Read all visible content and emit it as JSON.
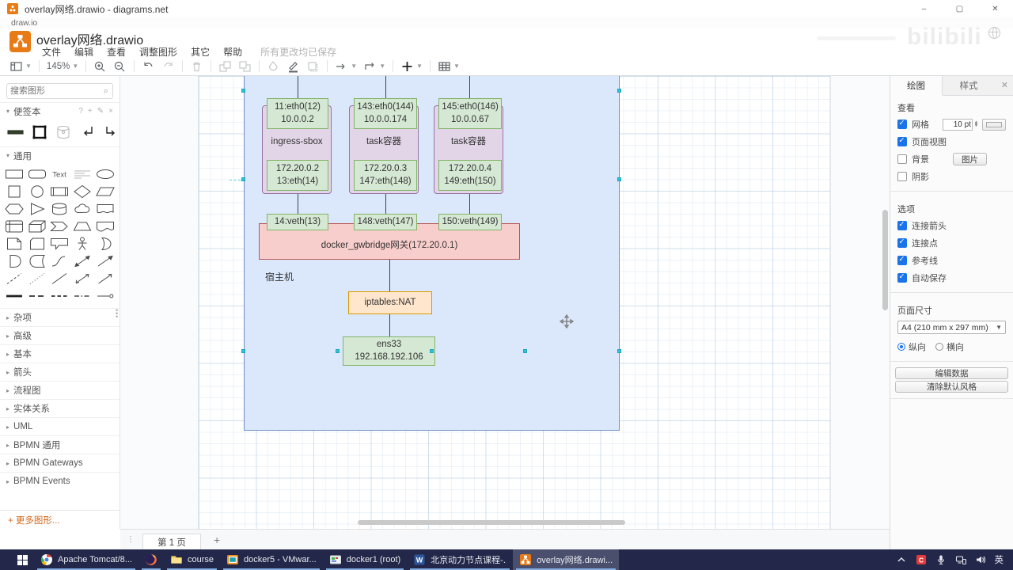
{
  "window": {
    "title": "overlay网络.drawio - diagrams.net",
    "app_strip": "draw.io",
    "controls": {
      "minimize": "–",
      "maximize": "▢",
      "close": "✕"
    }
  },
  "watermark": "bilibili",
  "header": {
    "doc_title": "overlay网络.drawio",
    "menu": [
      "文件",
      "编辑",
      "查看",
      "调整图形",
      "其它",
      "帮助"
    ],
    "saved_status": "所有更改均已保存"
  },
  "toolbar": {
    "zoom_level": "145%",
    "items": [
      {
        "icon": "layout-icon",
        "dd": true
      },
      {
        "sep": true
      },
      {
        "zoom": true,
        "dd": true
      },
      {
        "sep": true
      },
      {
        "icon": "zoom-in-icon"
      },
      {
        "icon": "zoom-out-icon"
      },
      {
        "sep": true
      },
      {
        "icon": "undo-icon"
      },
      {
        "icon": "redo-icon",
        "disabled": true
      },
      {
        "sep": true
      },
      {
        "icon": "delete-icon",
        "disabled": true
      },
      {
        "sep": true
      },
      {
        "icon": "to-front-icon",
        "disabled": true
      },
      {
        "icon": "to-back-icon",
        "disabled": true
      },
      {
        "sep": true
      },
      {
        "icon": "fill-color-icon",
        "disabled": true
      },
      {
        "icon": "line-color-icon"
      },
      {
        "icon": "shadow-icon",
        "disabled": true
      },
      {
        "sep": true
      },
      {
        "icon": "connection-arrow-icon",
        "dd": true
      },
      {
        "icon": "waypoint-icon",
        "dd": true
      },
      {
        "sep": true
      },
      {
        "icon": "insert-icon",
        "dd": true
      },
      {
        "sep": true
      },
      {
        "icon": "table-icon",
        "dd": true
      }
    ]
  },
  "sidebar": {
    "search_placeholder": "搜索图形",
    "scratchpad": {
      "title": "便签本",
      "tools": [
        "?",
        "+",
        "✎",
        "×"
      ],
      "items": [
        "thick-line-shape",
        "bold-square-shape",
        "disk-shape",
        "corner-arrow-left",
        "corner-arrow-right"
      ]
    },
    "general": {
      "title": "通用",
      "text_shape_label": "Text"
    },
    "shape_grid": [
      "rectangle",
      "rounded-rectangle",
      "text",
      "textbox",
      "ellipse",
      "square",
      "circle",
      "process",
      "diamond",
      "parallelogram",
      "hexagon",
      "triangle",
      "cylinder",
      "cloud",
      "document",
      "internal-storage",
      "cube",
      "step",
      "trapezoid",
      "tape",
      "note",
      "card",
      "callout",
      "actor",
      "or",
      "and",
      "data-storage",
      "curve",
      "bidirectional-arrow",
      "arrow",
      "dashed-line",
      "dotted-line",
      "line",
      "bidirectional-connector",
      "directional-connector",
      "bold-line",
      "dashed-edge",
      "dashed-edge-long",
      "dashdot-edge",
      "link-edge"
    ],
    "sections": [
      "杂项",
      "高级",
      "基本",
      "箭头",
      "流程图",
      "实体关系",
      "UML",
      "BPMN 通用",
      "BPMN Gateways",
      "BPMN Events"
    ],
    "more_shapes": "+ 更多图形..."
  },
  "diagram": {
    "host_label": "宿主机",
    "containers": [
      {
        "top1": "11:eth0(12)",
        "top2": "10.0.0.2",
        "name": "ingress-sbox",
        "bot1": "172.20.0.2",
        "bot2": "13:eth(14)",
        "veth": "14:veth(13)"
      },
      {
        "top1": "143:eth0(144)",
        "top2": "10.0.0.174",
        "name": "task容器",
        "bot1": "172.20.0.3",
        "bot2": "147:eth(148)",
        "veth": "148:veth(147)"
      },
      {
        "top1": "145:eth0(146)",
        "top2": "10.0.0.67",
        "name": "task容器",
        "bot1": "172.20.0.4",
        "bot2": "149:eth(150)",
        "veth": "150:veth(149)"
      }
    ],
    "bridge": "docker_gwbridge网关(172.20.0.1)",
    "nat": "iptables:NAT",
    "nic_line1": "ens33",
    "nic_line2": "192.168.192.106",
    "colors": {
      "container_fill": "#dbe8fc",
      "container_stroke": "#6c8ebf",
      "green_fill": "#d5e8d4",
      "green_stroke": "#82b366",
      "purple_fill": "#e1d5e7",
      "purple_stroke": "#9673a6",
      "red_fill": "#f8cecc",
      "red_stroke": "#b85450",
      "orange_fill": "#ffe6cc",
      "orange_stroke": "#d79b00"
    }
  },
  "footer": {
    "page_tab": "第 1 页",
    "add_page": "+"
  },
  "right_panel": {
    "tabs": {
      "diagram": "绘图",
      "style": "样式"
    },
    "view": {
      "title": "查看",
      "grid_label": "网格",
      "grid_checked": true,
      "grid_size": "10 pt",
      "page_view_label": "页面视图",
      "page_view_checked": true,
      "background_label": "背景",
      "background_checked": false,
      "image_button": "图片",
      "shadow_label": "阴影",
      "shadow_checked": false
    },
    "options": {
      "title": "选项",
      "items": [
        {
          "label": "连接箭头",
          "checked": true
        },
        {
          "label": "连接点",
          "checked": true
        },
        {
          "label": "参考线",
          "checked": true
        },
        {
          "label": "自动保存",
          "checked": true
        }
      ]
    },
    "page": {
      "title": "页面尺寸",
      "size_value": "A4 (210 mm x 297 mm)",
      "portrait": "纵向",
      "landscape": "横向",
      "orientation": "portrait"
    },
    "buttons": {
      "edit_data": "编辑数据",
      "clear_default": "清除默认风格"
    }
  },
  "taskbar": {
    "items": [
      {
        "name": "start",
        "icon": "windows-start-icon"
      },
      {
        "name": "chrome",
        "icon": "chrome-icon",
        "label": "Apache Tomcat/8...",
        "running": true
      },
      {
        "name": "firefox",
        "icon": "firefox-icon",
        "label": "",
        "running": true
      },
      {
        "name": "explorer-course",
        "icon": "folder-icon",
        "label": "course",
        "running": true
      },
      {
        "name": "vmware-docker5",
        "icon": "vmware-icon",
        "label": "docker5 - VMwar...",
        "running": true
      },
      {
        "name": "vmware-docker1",
        "icon": "console-icon",
        "label": "docker1 (root)",
        "running": true
      },
      {
        "name": "word-doc",
        "icon": "word-icon",
        "icon_letter": "W",
        "label": "北京动力节点课程-...",
        "running": true
      },
      {
        "name": "drawio",
        "icon": "drawio-icon",
        "label": "overlay网络.drawi...",
        "running": true,
        "active": true
      }
    ],
    "tray": [
      {
        "name": "tray-expand",
        "glyph": "chevron-up-icon"
      },
      {
        "name": "tray-recorder",
        "glyph": "record-icon",
        "letter": "C"
      },
      {
        "name": "tray-microphone",
        "glyph": "microphone-icon"
      },
      {
        "name": "tray-network",
        "glyph": "network-icon"
      },
      {
        "name": "tray-volume",
        "glyph": "volume-icon"
      },
      {
        "name": "tray-ime",
        "glyph": "ime-icon",
        "letter": "英"
      }
    ]
  }
}
